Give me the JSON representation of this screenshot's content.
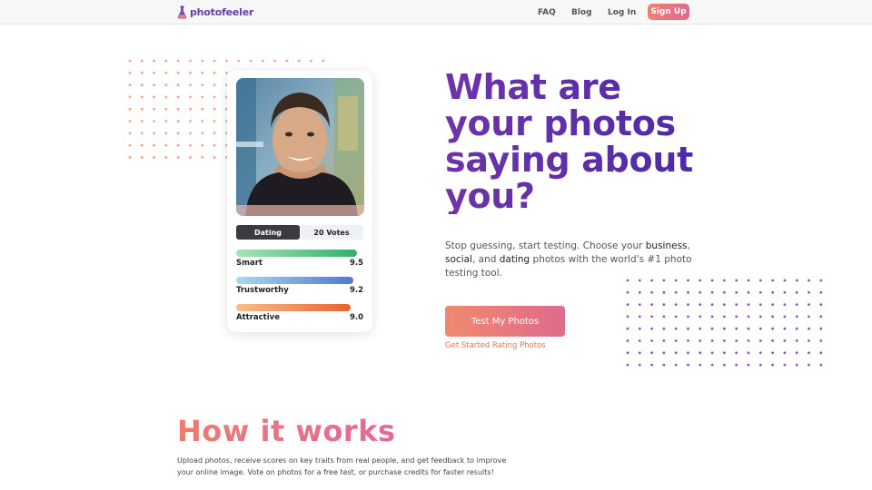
{
  "header": {
    "brand": "photofeeler",
    "nav": [
      "FAQ",
      "Blog",
      "Log In"
    ],
    "signup_label": "Sign Up"
  },
  "card": {
    "toggle_active": "Dating",
    "toggle_votes": "20 Votes",
    "metrics": [
      {
        "label": "Smart",
        "score": "9.5",
        "fill": 0.95
      },
      {
        "label": "Trustworthy",
        "score": "9.2",
        "fill": 0.92
      },
      {
        "label": "Attractive",
        "score": "9.0",
        "fill": 0.9
      }
    ]
  },
  "hero": {
    "headline_1": "What are",
    "headline_2": "your photos",
    "headline_3": "saying about",
    "headline_4": "you?",
    "sub_1": "Stop guessing, start testing. Choose your ",
    "sub_business": "business",
    "sub_2": ", ",
    "sub_social": "social",
    "sub_3": ", and ",
    "sub_dating": "dating",
    "sub_4": " photos with the world's #1 photo testing tool.",
    "cta_label": "Test My Photos",
    "cta_link": "Get Started Rating Photos"
  },
  "how": {
    "title": "How it works",
    "text": "Upload photos, receive scores on key traits from real people, and get feedback to improve your online image. Vote on photos for a free test, or purchase credits for faster results!"
  },
  "colors": {
    "brand_purple": "#6e34a8",
    "accent_coral": "#ec7d6f",
    "dot_salmon": "#f2a48e",
    "dot_purple": "#8a5ab8"
  }
}
